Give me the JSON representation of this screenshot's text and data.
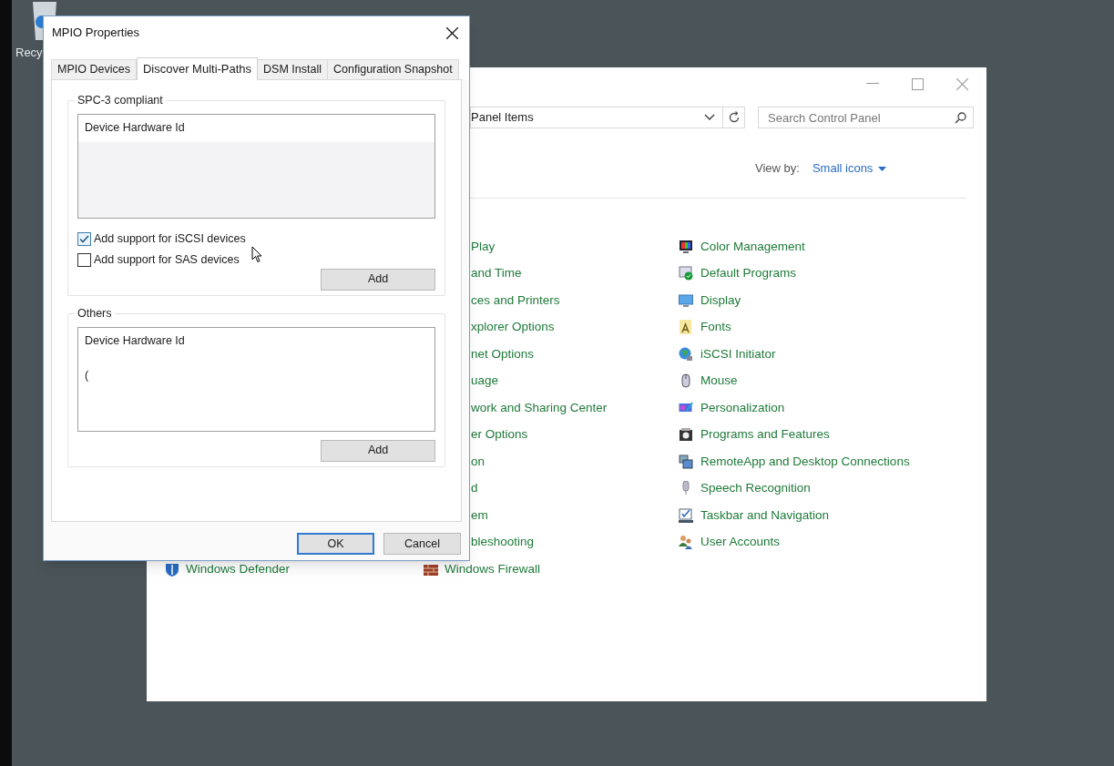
{
  "desktop": {
    "icons": [
      {
        "label": "Recy"
      }
    ]
  },
  "control_panel": {
    "address": "Panel Items",
    "search": {
      "placeholder": "Search Control Panel"
    },
    "view_by": {
      "label": "View by:",
      "value": "Small icons"
    },
    "column_1": [
      {
        "label": "Windows Defender",
        "kind": "full"
      }
    ],
    "column_2": [
      {
        "label": "Play",
        "kind": "clipped"
      },
      {
        "label": "and Time",
        "kind": "clipped"
      },
      {
        "label": "ces and Printers",
        "kind": "clipped"
      },
      {
        "label": "xplorer Options",
        "kind": "clipped"
      },
      {
        "label": "net Options",
        "kind": "clipped"
      },
      {
        "label": "uage",
        "kind": "clipped"
      },
      {
        "label": "work and Sharing Center",
        "kind": "clipped"
      },
      {
        "label": "er Options",
        "kind": "clipped"
      },
      {
        "label": "on",
        "kind": "clipped"
      },
      {
        "label": "d",
        "kind": "clipped"
      },
      {
        "label": "em",
        "kind": "clipped"
      },
      {
        "label": "bleshooting",
        "kind": "clipped"
      },
      {
        "label": "Windows Firewall",
        "kind": "full"
      }
    ],
    "column_3": [
      {
        "label": "Color Management"
      },
      {
        "label": "Default Programs"
      },
      {
        "label": "Display"
      },
      {
        "label": "Fonts"
      },
      {
        "label": "iSCSI Initiator"
      },
      {
        "label": "Mouse"
      },
      {
        "label": "Personalization"
      },
      {
        "label": "Programs and Features"
      },
      {
        "label": "RemoteApp and Desktop Connections"
      },
      {
        "label": "Speech Recognition"
      },
      {
        "label": "Taskbar and Navigation"
      },
      {
        "label": "User Accounts"
      }
    ]
  },
  "dialog": {
    "title": "MPIO Properties",
    "tabs": [
      {
        "label": "MPIO Devices",
        "selected": false
      },
      {
        "label": "Discover Multi-Paths",
        "selected": true
      },
      {
        "label": "DSM Install",
        "selected": false
      },
      {
        "label": "Configuration Snapshot",
        "selected": false
      }
    ],
    "groups": [
      {
        "title": "SPC-3 compliant",
        "list": {
          "header": "Device Hardware Id"
        },
        "checkboxes": [
          {
            "label": "Add support for iSCSI devices",
            "checked": true
          },
          {
            "label": "Add support for SAS devices",
            "checked": false
          }
        ],
        "button": "Add"
      },
      {
        "title": "Others",
        "list": {
          "header": "Device Hardware Id",
          "rows": [
            "("
          ]
        },
        "button": "Add"
      }
    ],
    "buttons": [
      {
        "label": "OK",
        "default": true
      },
      {
        "label": "Cancel",
        "default": false
      }
    ]
  }
}
